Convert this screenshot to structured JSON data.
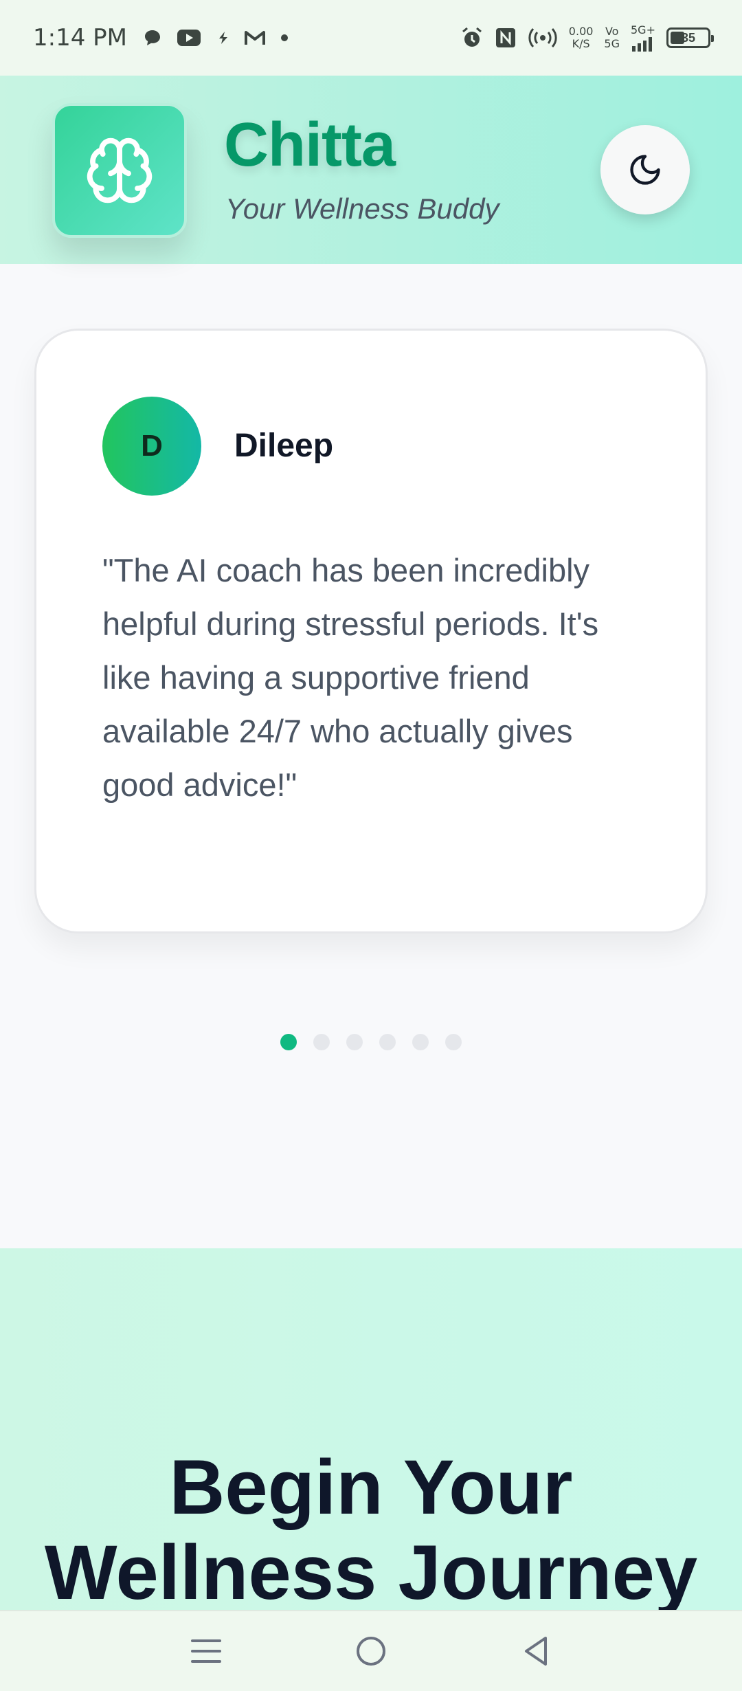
{
  "status_bar": {
    "time": "1:14 PM",
    "network_speed_value": "0.00",
    "network_speed_unit": "K/S",
    "volte_top": "Vo",
    "volte_bottom": "5G",
    "signal_label": "5G+",
    "battery_level": "35",
    "icons": [
      "message-icon",
      "youtube-icon",
      "flash-icon",
      "gmail-icon",
      "dot-icon",
      "alarm-icon",
      "nfc-icon",
      "hotspot-icon",
      "signal-icon",
      "battery-icon"
    ]
  },
  "header": {
    "app_name": "Chitta",
    "tagline": "Your Wellness Buddy",
    "logo_icon": "brain-icon",
    "theme_toggle_icon": "moon-icon"
  },
  "testimonial": {
    "avatar_initial": "D",
    "author": "Dileep",
    "quote": "\"The AI coach has been incredibly helpful during stressful periods. It's like having a supportive friend available 24/7 who actually gives good advice!\"",
    "total_slides": 6,
    "active_slide": 1
  },
  "cta": {
    "title_line1": "Begin Your",
    "title_line2": "Wellness Journey"
  },
  "nav_bar": {
    "icons": [
      "menu-icon",
      "home-icon",
      "back-icon"
    ]
  },
  "colors": {
    "brand_green": "#069868",
    "accent": "#10b981",
    "header_gradient_start": "#c7f4e2",
    "header_gradient_end": "#9ef0de"
  }
}
